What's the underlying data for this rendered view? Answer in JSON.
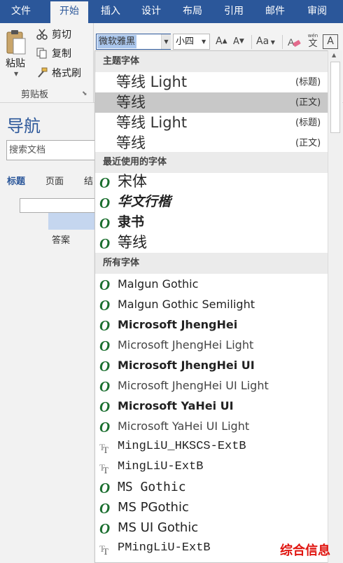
{
  "tabs": [
    "文件",
    "开始",
    "插入",
    "设计",
    "布局",
    "引用",
    "邮件",
    "审阅"
  ],
  "active_tab": "开始",
  "clipboard": {
    "paste_label": "粘贴",
    "cut_label": "剪切",
    "copy_label": "复制",
    "format_painter_label": "格式刷",
    "group_title": "剪贴板"
  },
  "font_toolbar": {
    "font_name": "微软雅黑",
    "font_size": "小四",
    "grow": "A",
    "shrink": "A",
    "case": "Aa",
    "phonetic_top": "wén",
    "phonetic_bottom": "文",
    "border_char": "A"
  },
  "navigation": {
    "title": "导航",
    "search_placeholder": "搜索文档",
    "tabs": [
      "标题",
      "页面",
      "结"
    ],
    "result_text": "答案"
  },
  "dropdown": {
    "theme_header": "主题字体",
    "theme_fonts": [
      {
        "name": "等线 Light",
        "role": "(标题)",
        "selected": false
      },
      {
        "name": "等线",
        "role": "(正文)",
        "selected": true
      },
      {
        "name": "等线 Light",
        "role": "(标题)",
        "selected": false
      },
      {
        "name": "等线",
        "role": "(正文)",
        "selected": false
      }
    ],
    "recent_header": "最近使用的字体",
    "recent_fonts": [
      "宋体",
      "华文行楷",
      "隶书",
      "等线"
    ],
    "all_header": "所有字体",
    "all_fonts": [
      {
        "name": "Malgun Gothic",
        "icon": "opentype-icon"
      },
      {
        "name": "Malgun Gothic Semilight",
        "icon": "opentype-icon"
      },
      {
        "name": "Microsoft JhengHei",
        "icon": "opentype-icon"
      },
      {
        "name": "Microsoft JhengHei Light",
        "icon": "opentype-icon"
      },
      {
        "name": "Microsoft JhengHei UI",
        "icon": "opentype-icon"
      },
      {
        "name": "Microsoft JhengHei UI Light",
        "icon": "opentype-icon"
      },
      {
        "name": "Microsoft YaHei UI",
        "icon": "opentype-icon"
      },
      {
        "name": "Microsoft YaHei UI Light",
        "icon": "opentype-icon"
      },
      {
        "name": "MingLiU_HKSCS-ExtB",
        "icon": "truetype-icon"
      },
      {
        "name": "MingLiU-ExtB",
        "icon": "truetype-icon"
      },
      {
        "name": "MS Gothic",
        "icon": "opentype-icon"
      },
      {
        "name": "MS PGothic",
        "icon": "opentype-icon"
      },
      {
        "name": "MS UI Gothic",
        "icon": "opentype-icon"
      },
      {
        "name": "PMingLiU-ExtB",
        "icon": "truetype-icon"
      }
    ]
  },
  "watermark": "综合信息",
  "colors": {
    "ribbon_blue": "#2b579a",
    "selected_item": "#c8c8c8",
    "opentype_green": "#1a6e2e",
    "watermark_red": "#e0140f"
  }
}
